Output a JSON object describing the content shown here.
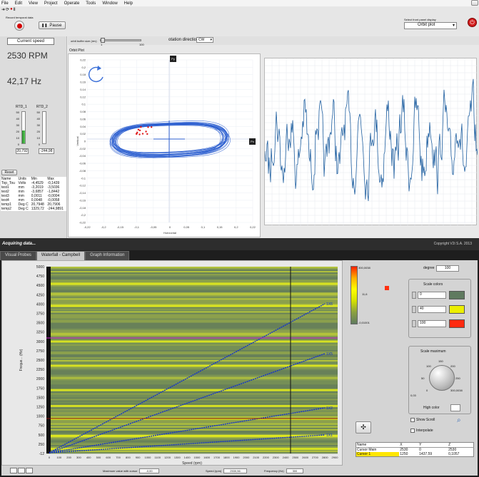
{
  "menu": [
    "File",
    "Edit",
    "View",
    "Project",
    "Operate",
    "Tools",
    "Window",
    "Help"
  ],
  "toolbar": {
    "record_label": "Record temporal data",
    "pause_label": "Pause",
    "front_panel_label": "Select front panel display",
    "front_panel_value": "Orbit plot"
  },
  "left_panel": {
    "current_speed_label": "Current speed",
    "rpm": "2530 RPM",
    "hz": "42,17 Hz",
    "rtd1": {
      "label": "RTD_1",
      "value": "20,792",
      "ticks": [
        "50",
        "40",
        "30",
        "20",
        "10",
        "0"
      ],
      "level": 20.8
    },
    "rtd2": {
      "label": "RTD_2",
      "value": "-244,98",
      "ticks": [
        "50",
        "40",
        "30",
        "20",
        "10",
        "0"
      ],
      "level": 0
    },
    "reset_label": "Reset",
    "table_headers": [
      "Name",
      "Units",
      "Min",
      "Max"
    ],
    "table_rows": [
      [
        "Top_Tou",
        "Volts",
        "-4,4529",
        "-0,1439"
      ],
      [
        "test1",
        "mm",
        "-3,2019",
        "-3,5036"
      ],
      [
        "test2",
        "mm",
        "-3,6857",
        "-1,8442"
      ],
      [
        "test3",
        "mm",
        "0,0011",
        "-0,0004"
      ],
      [
        "test4",
        "mm",
        "0,0048",
        "-0,0058"
      ],
      [
        "temp1",
        "Deg C",
        "20,7948",
        "20,7906"
      ],
      [
        "temp2",
        "Deg C",
        "1329,72",
        "-244,9891"
      ]
    ]
  },
  "orbit": {
    "buffer_label": "orbit buffer size (rev)",
    "buffer_min": "1",
    "buffer_max": "100",
    "rotation_label": "otation direction",
    "rotation_value": "CW",
    "plot_title": "Orbit Plot",
    "py_label": "Py",
    "px_label": "Px",
    "xlabel": "Horizontal",
    "ylabel": "Vertical",
    "yticks": [
      "0,22",
      "0,2",
      "0,18",
      "0,16",
      "0,14",
      "0,12",
      "0,1",
      "0,08",
      "0,06",
      "0,04",
      "0,02",
      "0",
      "-0,02",
      "-0,04",
      "-0,06",
      "-0,08",
      "-0,1",
      "-0,12",
      "-0,14",
      "-0,16",
      "-0,18",
      "-0,2",
      "-0,22"
    ],
    "xticks": [
      "-0,22",
      "-0,2",
      "-0,15",
      "-0,1",
      "-0,05",
      "0",
      "0,05",
      "0,1",
      "0,15",
      "0,2",
      "0,22"
    ]
  },
  "status": {
    "left": "Acquiring data...",
    "right": "Copyright V2i S.A. 2013"
  },
  "tabs": [
    "Visual Probes",
    "Waterfall - Campbell",
    "Graph Information"
  ],
  "campbell": {
    "ylabel": "Freque... (Hz)",
    "xlabel": "Speed (rpm)",
    "yticks": [
      "5000",
      "4750",
      "4500",
      "4250",
      "4000",
      "3750",
      "3500",
      "3250",
      "3000",
      "2750",
      "2500",
      "2250",
      "2000",
      "1750",
      "1500",
      "1250",
      "1000",
      "750",
      "500",
      "250",
      "-12"
    ],
    "xticks": [
      "0",
      "100",
      "200",
      "300",
      "400",
      "500",
      "600",
      "700",
      "800",
      "900",
      "1000",
      "1100",
      "1200",
      "1300",
      "1400",
      "1500",
      "1600",
      "1700",
      "1800",
      "1900",
      "2000",
      "2100",
      "2200",
      "2300",
      "2400",
      "2500",
      "2600",
      "2700",
      "2800",
      "2900"
    ],
    "order_labels": [
      "1X6",
      "1X5",
      "1X2",
      "1X1"
    ],
    "colorbar_ticks": [
      "300,0038",
      "11,6",
      "-0,01001"
    ],
    "degree_label": "degree",
    "degree_value": "100",
    "scale_colors_label": "Scale colors",
    "scale_colors": [
      {
        "value": "0",
        "color": "#5f7a5f"
      },
      {
        "value": "40",
        "color": "#ecef00"
      },
      {
        "value": "100",
        "color": "#ff2a10"
      }
    ],
    "scale_max_label": "Scale maximum",
    "knob_ticks": [
      "0",
      "50",
      "100",
      "150",
      "200",
      "250",
      "300,0038"
    ],
    "knob_value": "0,03",
    "high_color_label": "High color",
    "show_scroll_label": "Show Scroll",
    "interpolate_label": "Interpolate",
    "cursor_table_headers": [
      "Name",
      "X",
      "Y",
      "Z"
    ],
    "cursor_rows": [
      [
        "Cursor Main",
        "2530",
        "0",
        "2530"
      ],
      [
        "Cursor 1",
        "1250",
        "1437,59",
        "0,1057"
      ]
    ],
    "bottom_fields": [
      {
        "label": "Maximum value with cursor",
        "value": "-0,00"
      },
      {
        "label": "Speed (rpm)",
        "value": "2530,56"
      },
      {
        "label": "Frequency (Hz)",
        "value": "300"
      }
    ]
  },
  "colors": {
    "orbit_trace": "#2d5fd0",
    "spectrum_trace": "#1f5fa0",
    "stop_button": "#d21e1e",
    "magenta_line": "#d020d0",
    "order_line": "#1030d0"
  }
}
